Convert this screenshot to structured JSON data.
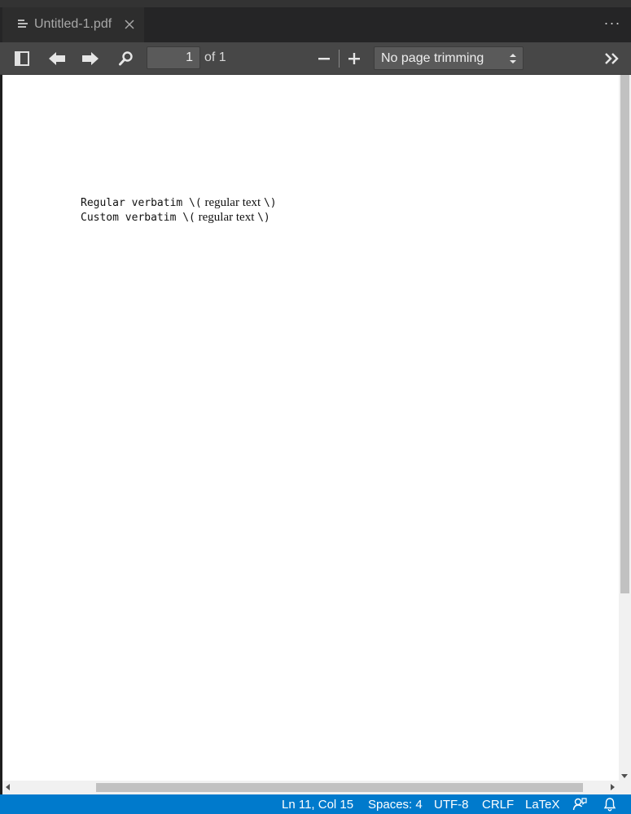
{
  "tab": {
    "title": "Untitled-1.pdf",
    "file_icon": "file-lines-icon",
    "close_icon": "close-icon"
  },
  "titlebar": {
    "more_icon": "more-actions-icon",
    "more_glyph": "···"
  },
  "toolbar": {
    "sidebar_icon": "sidebar-toggle-icon",
    "prev_icon": "arrow-left-icon",
    "next_icon": "arrow-right-icon",
    "find_icon": "search-icon",
    "page_number": "1",
    "page_of": "of 1",
    "zoom_out_icon": "minus-icon",
    "zoom_in_icon": "plus-icon",
    "trim_select": "No page trimming",
    "tools_icon": "double-chevron-right-icon"
  },
  "document": {
    "line1": {
      "verbatim": "Regular verbatim \\(",
      "text": " regular text ",
      "close": "\\)"
    },
    "line2": {
      "verbatim": "Custom verbatim \\(",
      "text": " regular text ",
      "close": "\\)"
    }
  },
  "statusbar": {
    "position": "Ln 11, Col 15",
    "spaces": "Spaces: 4",
    "encoding": "UTF-8",
    "eol": "CRLF",
    "language": "LaTeX",
    "feedback_icon": "feedback-icon",
    "bell_icon": "bell-icon"
  },
  "colors": {
    "accent": "#007acc",
    "toolbar": "#474747",
    "tabbar": "#252526"
  }
}
